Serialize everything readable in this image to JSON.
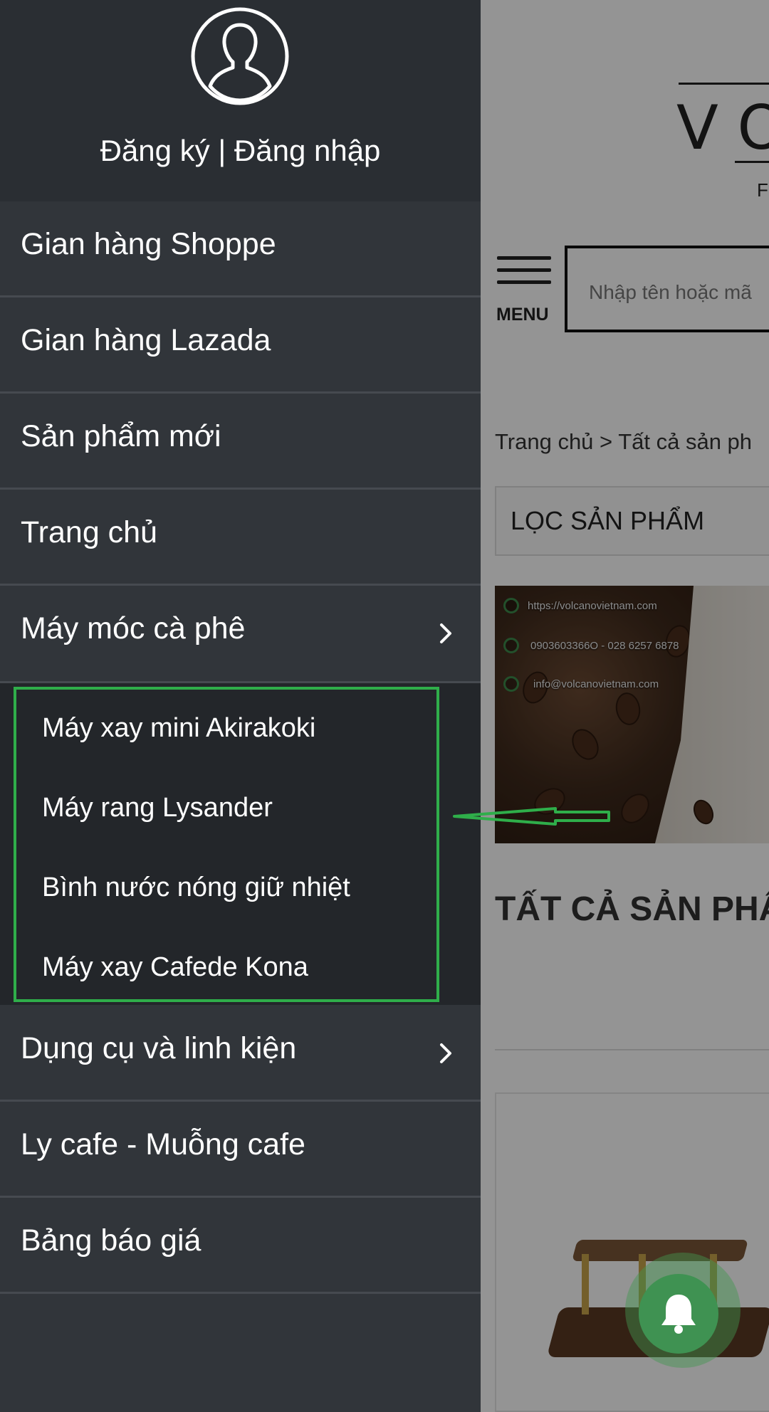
{
  "drawer": {
    "auth_link": "Đăng ký | Đăng nhập",
    "items": [
      {
        "label": "Gian hàng Shoppe"
      },
      {
        "label": "Gian hàng Lazada"
      },
      {
        "label": "Sản phẩm mới"
      },
      {
        "label": "Trang chủ"
      },
      {
        "label": "Máy móc cà phê",
        "expanded": true
      },
      {
        "label": "Dụng cụ và linh kiện"
      },
      {
        "label": "Ly cafe - Muỗng cafe"
      },
      {
        "label": "Bảng báo giá"
      }
    ],
    "submenu": [
      {
        "label": "Máy xay mini Akirakoki"
      },
      {
        "label": "Máy rang Lysander"
      },
      {
        "label": "Bình nước nóng giữ nhiệt"
      },
      {
        "label": "Máy xay Cafede Kona"
      }
    ]
  },
  "background_page": {
    "logo_text": "VO",
    "logo_sub": "F",
    "menu_label": "MENU",
    "search_placeholder": "Nhập tên hoặc mã",
    "breadcrumb": "Trang chủ > Tất cả sản ph",
    "filter_label": "LỌC SẢN PHẨM",
    "banner": {
      "website": "https://volcanovietnam.com",
      "phone": "0903603366O - 028 6257 6878",
      "email": "info@volcanovietnam.com"
    },
    "section_heading": "TẤT CẢ SẢN PHẨ"
  },
  "colors": {
    "drawer_bg": "#31353a",
    "drawer_header_bg": "#2a2e33",
    "submenu_bg": "#23262a",
    "annotation": "#2fae4a",
    "bell": "#3f9252"
  },
  "icons": {
    "avatar": "user-silhouette-icon",
    "chevron": "chevron-right-icon",
    "bell": "bell-icon",
    "menu": "hamburger-icon"
  }
}
